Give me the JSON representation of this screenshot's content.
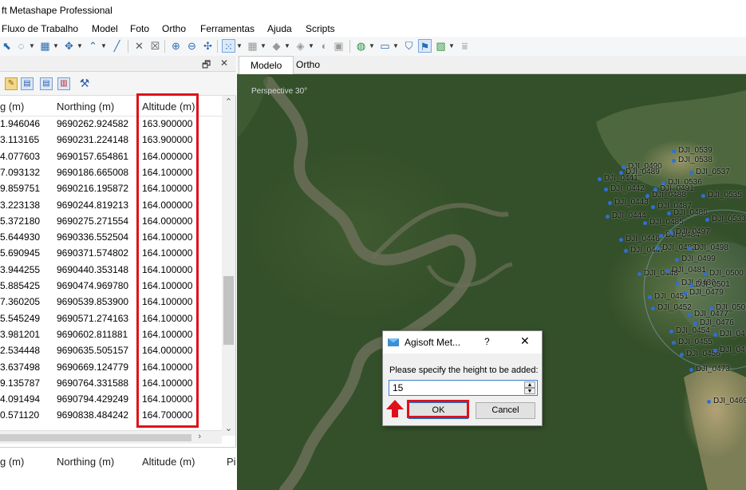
{
  "app": {
    "title": "ft Metashape Professional"
  },
  "menu": [
    "Fluxo de Trabalho",
    "Model",
    "Foto",
    "Ortho",
    "Ferramentas",
    "Ajuda",
    "Scripts"
  ],
  "panel": {
    "float_button": "🗗",
    "close_button": "✕",
    "columns": {
      "easting": "g (m)",
      "northing": "Northing (m)",
      "altitude": "Altitude (m)"
    },
    "rows": [
      {
        "e": "1.946046",
        "n": "9690262.924582",
        "a": "163.900000"
      },
      {
        "e": "3.113165",
        "n": "9690231.224148",
        "a": "163.900000"
      },
      {
        "e": "4.077603",
        "n": "9690157.654861",
        "a": "164.000000"
      },
      {
        "e": "7.093132",
        "n": "9690186.665008",
        "a": "164.100000"
      },
      {
        "e": "9.859751",
        "n": "9690216.195872",
        "a": "164.100000"
      },
      {
        "e": "3.223138",
        "n": "9690244.819213",
        "a": "164.000000"
      },
      {
        "e": "5.372180",
        "n": "9690275.271554",
        "a": "164.000000"
      },
      {
        "e": "5.644930",
        "n": "9690336.552504",
        "a": "164.100000"
      },
      {
        "e": "5.690945",
        "n": "9690371.574802",
        "a": "164.100000"
      },
      {
        "e": "3.944255",
        "n": "9690440.353148",
        "a": "164.100000"
      },
      {
        "e": "5.885425",
        "n": "9690474.969780",
        "a": "164.100000"
      },
      {
        "e": "7.360205",
        "n": "9690539.853900",
        "a": "164.100000"
      },
      {
        "e": "5.545249",
        "n": "9690571.274163",
        "a": "164.100000"
      },
      {
        "e": "3.981201",
        "n": "9690602.811881",
        "a": "164.100000"
      },
      {
        "e": "2.534448",
        "n": "9690635.505157",
        "a": "164.000000"
      },
      {
        "e": "3.637498",
        "n": "9690669.124779",
        "a": "164.100000"
      },
      {
        "e": "9.135787",
        "n": "9690764.331588",
        "a": "164.100000"
      },
      {
        "e": "4.091494",
        "n": "9690794.429249",
        "a": "164.100000"
      },
      {
        "e": "0.571120",
        "n": "9690838.484242",
        "a": "164.700000"
      }
    ],
    "lower_columns": {
      "easting": "g (m)",
      "northing": "Northing (m)",
      "altitude": "Altitude (m)",
      "extra": "Pi"
    }
  },
  "view": {
    "tabs": [
      "Modelo",
      "Ortho"
    ],
    "perspective": "Perspective 30°",
    "cameras": [
      "DJI_0539",
      "DJI_0538",
      "DJI_0490",
      "DJI_0489",
      "DJI_0537",
      "DJI_0441",
      "DJI_0536",
      "DJI_0442",
      "DJI_0491",
      "DJI_0488",
      "DJI_0535",
      "DJI_0443",
      "DJI_0487",
      "DJI_0486",
      "DJI_0444",
      "DJI_0485",
      "DJI_0533",
      "DJI_0446",
      "DJI_0484",
      "DJI_0497",
      "DJI_0447",
      "DJI_0483",
      "DJI_0498",
      "DJI_0499",
      "DJI_0448",
      "DJI_0481",
      "DJI_0500",
      "DJI_0480",
      "DJI_0501",
      "DJI_0451",
      "DJI_0479",
      "DJI_0452",
      "DJI_0503",
      "DJI_0477",
      "DJI_0454",
      "DJI_0476",
      "DJI_0455",
      "DJI_0475",
      "DJI_0456",
      "DJI_0471",
      "DJI_0473",
      "DJI_0469"
    ]
  },
  "dialog": {
    "title": "Agisoft Met...",
    "help": "?",
    "close": "✕",
    "label": "Please specify the height to be added:",
    "value": "15",
    "ok": "OK",
    "cancel": "Cancel"
  }
}
